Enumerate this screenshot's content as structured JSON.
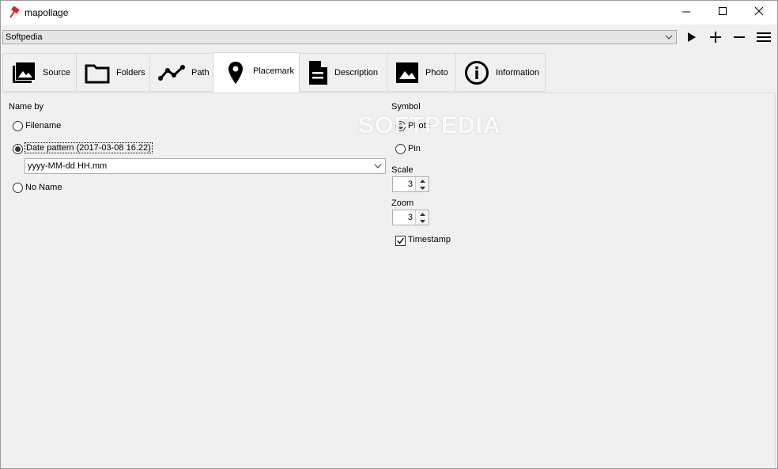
{
  "window": {
    "title": "mapollage",
    "controls": {
      "minimize": "minimize-icon",
      "maximize": "maximize-icon",
      "close": "close-icon"
    }
  },
  "toolbar": {
    "profile_value": "Softpedia",
    "buttons": [
      "play-icon",
      "plus-icon",
      "minus-icon",
      "menu-icon"
    ]
  },
  "tabs": [
    {
      "label": "Source",
      "icon": "photo-library-icon"
    },
    {
      "label": "Folders",
      "icon": "folder-icon"
    },
    {
      "label": "Path",
      "icon": "path-icon"
    },
    {
      "label": "Placemark",
      "icon": "map-pin-icon",
      "active": true
    },
    {
      "label": "Description",
      "icon": "document-icon"
    },
    {
      "label": "Photo",
      "icon": "image-icon"
    },
    {
      "label": "Information",
      "icon": "info-icon"
    }
  ],
  "placemark": {
    "name_by": {
      "heading": "Name by",
      "options": [
        "Filename",
        "Date pattern (2017-03-08 16.22)",
        "No Name"
      ],
      "selected": "Date pattern (2017-03-08 16.22)",
      "date_pattern": "yyyy-MM-dd HH.mm"
    },
    "symbol": {
      "heading": "Symbol",
      "options": [
        "Photo",
        "Pin"
      ],
      "selected": "Photo"
    },
    "scale": {
      "label": "Scale",
      "value": "3"
    },
    "zoom": {
      "label": "Zoom",
      "value": "3"
    },
    "timestamp": {
      "label": "Timestamp",
      "checked": true
    }
  },
  "watermark": "SOFTPEDIA",
  "colors": {
    "app_icon": "#d9262b",
    "window_bg": "#f0f0f0",
    "titlebar_bg": "#ffffff"
  }
}
